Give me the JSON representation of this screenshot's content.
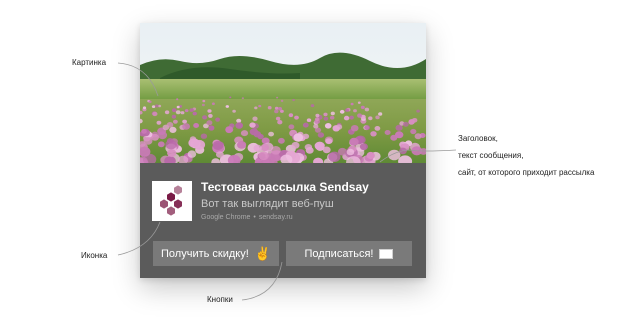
{
  "notification": {
    "title": "Тестовая рассылка Sendsay",
    "message": "Вот так выглядит веб-пуш",
    "browser": "Google Chrome",
    "separator": "•",
    "site": "sendsay.ru",
    "buttons": {
      "discount_label": "Получить скидку!",
      "discount_icon": "hand-icon",
      "subscribe_label": "Подписаться!",
      "subscribe_icon": "mail-icon"
    },
    "colors": {
      "card_background": "#5b5b5b",
      "button_background": "#7a7a7a",
      "logo_color": "#7a1a46"
    }
  },
  "annotations": {
    "picture": "Картинка",
    "icon": "Иконка",
    "buttons": "Кнопки",
    "texts": [
      "Заголовок,",
      "текст сообщения,",
      "сайт, от которого приходит рассылка"
    ]
  }
}
